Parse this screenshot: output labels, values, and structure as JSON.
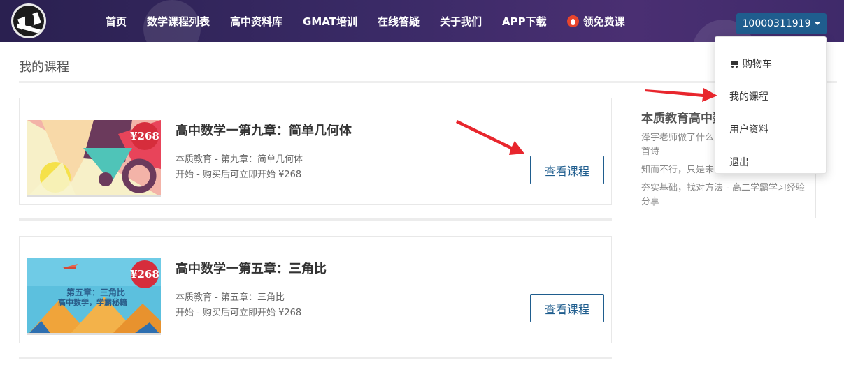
{
  "nav": {
    "links": [
      "首页",
      "数学课程列表",
      "高中资料库",
      "GMAT培训",
      "在线答疑",
      "关于我们",
      "APP下载",
      "领免费课"
    ],
    "user_label": "10000311919"
  },
  "page": {
    "title": "我的课程"
  },
  "courses": [
    {
      "title": "高中数学一第九章：简单几何体",
      "meta_line1": "本质教育 - 第九章：简单几何体",
      "meta_line2": "开始 - 购买后可立即开始 ¥268",
      "price_badge": "¥268",
      "button_label": "查看课程"
    },
    {
      "title": "高中数学一第五章：三角比",
      "meta_line1": "本质教育 - 第五章：三角比",
      "meta_line2": "开始 - 购买后可立即开始 ¥268",
      "price_badge": "¥268",
      "button_label": "查看课程",
      "thumb_text_1": "第五章：三角比",
      "thumb_text_2": "高中数学，学霸秘籍"
    }
  ],
  "sidebar": {
    "title": "本质教育高中数",
    "items": [
      "泽宇老师做了什么",
      "首诗",
      "知而不行，只是未",
      "夯实基础，找对方法 - 高二学霸学习经验",
      "分享"
    ]
  },
  "dropdown": {
    "items": [
      "购物车",
      "我的课程",
      "用户资料",
      "退出"
    ]
  },
  "colors": {
    "nav_bg": "#2a2050",
    "accent": "#1f5d8e",
    "price_red": "#d62d3c",
    "arrow_red": "#e8262d"
  }
}
